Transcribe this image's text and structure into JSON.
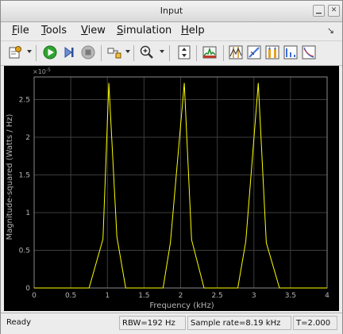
{
  "window": {
    "title": "Input"
  },
  "menu": {
    "file": {
      "underline": "F",
      "rest": "ile"
    },
    "tools": {
      "underline": "T",
      "rest": "ools"
    },
    "view": {
      "underline": "V",
      "rest": "iew"
    },
    "simulation": {
      "underline": "S",
      "rest": "imulation"
    },
    "help": {
      "underline": "H",
      "rest": "elp"
    }
  },
  "status": {
    "state": "Ready",
    "rbw": "RBW=192 Hz",
    "sample_rate": "Sample rate=8.19 kHz",
    "time": "T=2.000"
  },
  "chart_data": {
    "type": "line",
    "xlabel": "Frequency (kHz)",
    "ylabel": "Magnitude-squared (Watts / Hz)",
    "exponent_label": "×10",
    "exponent_power": "-5",
    "xlim": [
      0,
      4
    ],
    "ylim": [
      0,
      2.8
    ],
    "xticks": [
      "0",
      "0.5",
      "1",
      "1.5",
      "2",
      "2.5",
      "3",
      "3.5",
      "4"
    ],
    "yticks": [
      "0",
      "0.5",
      "1",
      "1.5",
      "2",
      "2.5"
    ],
    "grid": true,
    "series": [
      {
        "color": "#ffff00",
        "x": [
          0,
          0.75,
          0.94,
          1.02,
          1.13,
          1.25,
          1.76,
          1.86,
          2.05,
          2.15,
          2.32,
          2.78,
          2.89,
          3.06,
          3.17,
          3.35,
          4.0
        ],
        "y": [
          0,
          0,
          0.65,
          2.72,
          0.68,
          0,
          0,
          0.6,
          2.72,
          0.64,
          0,
          0,
          0.62,
          2.72,
          0.6,
          0,
          0
        ]
      }
    ]
  }
}
